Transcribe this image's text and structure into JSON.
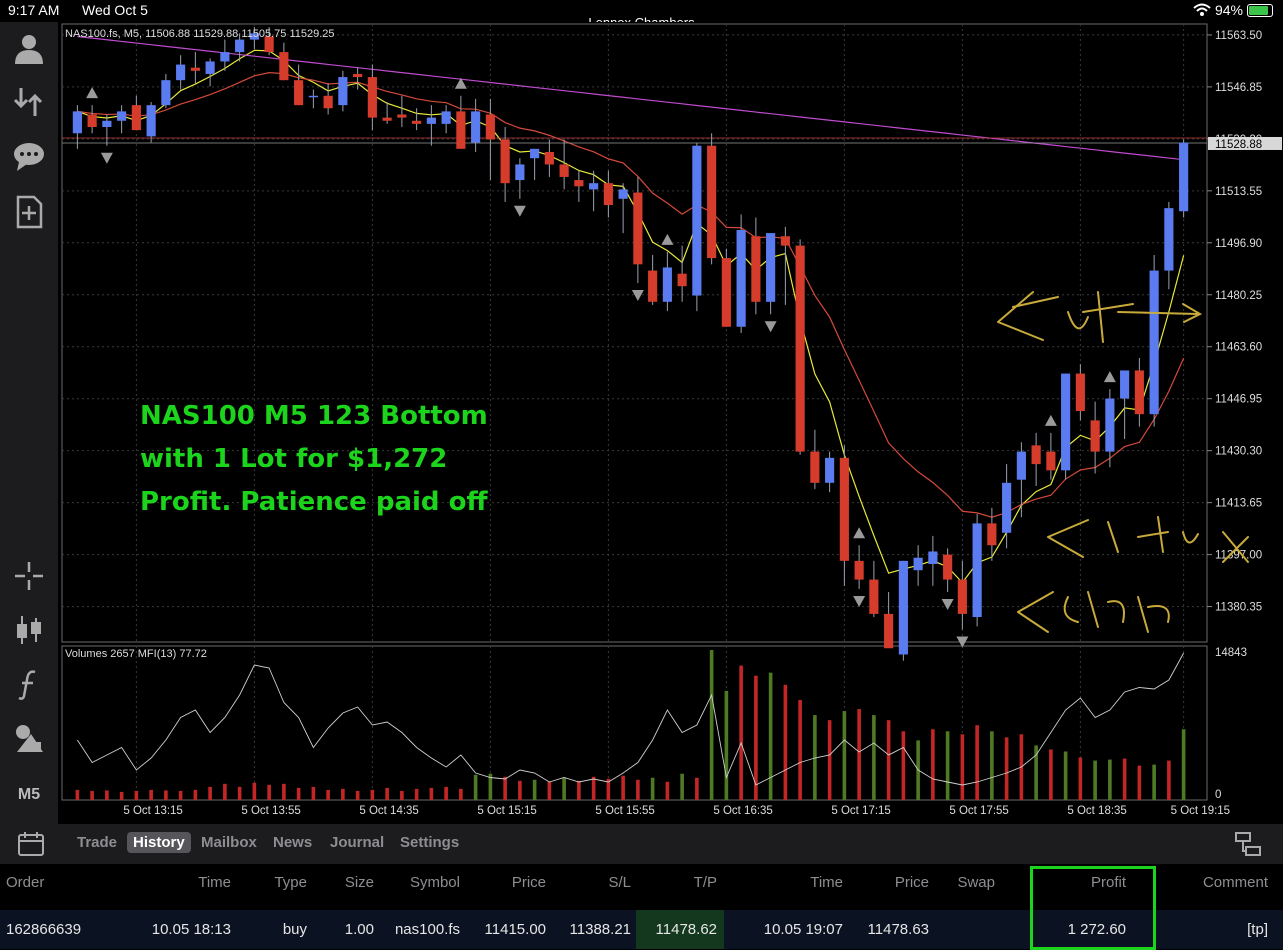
{
  "status_bar": {
    "time": "9:17 AM",
    "date": "Wed Oct 5",
    "battery": "94%"
  },
  "account_name": "Lennox Chambers",
  "chart_header": "NAS100.fs, M5, 11506.88 11529.88 11505.75 11529.25",
  "volume_header": "Volumes 2657 MFI(13) 77.72",
  "timeframe": "M5",
  "annotation": {
    "line1": "NAS100 M5 123 Bottom",
    "line2": "with 1 Lot for $1,272",
    "line3": "Profit. Patience paid off",
    "handwritten": [
      "Exit",
      "Entry",
      "Stop"
    ]
  },
  "tabs": [
    "Trade",
    "History",
    "Mailbox",
    "News",
    "Journal",
    "Settings"
  ],
  "active_tab": "History",
  "columns": [
    "Order",
    "Time",
    "Type",
    "Size",
    "Symbol",
    "Price",
    "S/L",
    "T/P",
    "Time",
    "Price",
    "Swap",
    "Profit",
    "Comment"
  ],
  "row": {
    "order": "162866639",
    "open_time": "10.05 18:13",
    "type": "buy",
    "size": "1.00",
    "symbol": "nas100.fs",
    "price": "11415.00",
    "sl": "11388.21",
    "tp": "11478.62",
    "close_time": "10.05 19:07",
    "close_price": "11478.63",
    "swap": "",
    "profit": "1 272.60",
    "comment": "[tp]"
  },
  "colors": {
    "bull": "#5b7cf0",
    "bear": "#d63c2c",
    "ma_fast": "#e8e83a",
    "ma_mid": "#d44a3a",
    "ma_slow": "#c04ad0",
    "vol_up": "#4f7a24",
    "vol_down": "#c42626",
    "highlight": "#1bd41b"
  },
  "chart_data": {
    "type": "candlestick",
    "title": "NAS100.fs, M5",
    "price_ticks": [
      "11563.50",
      "11546.85",
      "11530.20",
      "11513.55",
      "11496.90",
      "11480.25",
      "11463.60",
      "11446.95",
      "11430.30",
      "11413.65",
      "11397.00",
      "11380.35"
    ],
    "current_price_label": "11528.88",
    "ylim": [
      11369,
      11567
    ],
    "time_ticks": [
      "5 Oct 13:15",
      "5 Oct 13:55",
      "5 Oct 14:35",
      "5 Oct 15:15",
      "5 Oct 15:55",
      "5 Oct 16:35",
      "5 Oct 17:15",
      "5 Oct 17:55",
      "5 Oct 18:35",
      "5 Oct 19:15"
    ],
    "volume_ticks": [
      "14843",
      "0"
    ],
    "candles": [
      [
        11532,
        11541,
        11527,
        11539
      ],
      [
        11538,
        11541,
        11532,
        11534
      ],
      [
        11534,
        11538,
        11528,
        11536
      ],
      [
        11536,
        11541,
        11532,
        11539
      ],
      [
        11541,
        11544,
        11534,
        11533
      ],
      [
        11531,
        11542,
        11529,
        11541
      ],
      [
        11541,
        11551,
        11540,
        11549
      ],
      [
        11549,
        11557,
        11546,
        11554
      ],
      [
        11553,
        11558,
        11548,
        11552
      ],
      [
        11551,
        11556,
        11547,
        11555
      ],
      [
        11555,
        11562,
        11552,
        11558
      ],
      [
        11558,
        11564,
        11555,
        11562
      ],
      [
        11562,
        11566,
        11559,
        11564
      ],
      [
        11563,
        11566,
        11557,
        11558
      ],
      [
        11558,
        11561,
        11549,
        11549
      ],
      [
        11549,
        11554,
        11541,
        11541
      ],
      [
        11544,
        11546,
        11540,
        11544
      ],
      [
        11544,
        11548,
        11538,
        11540
      ],
      [
        11541,
        11552,
        11539,
        11550
      ],
      [
        11551,
        11553,
        11546,
        11550
      ],
      [
        11550,
        11554,
        11533,
        11537
      ],
      [
        11537,
        11542,
        11535,
        11536
      ],
      [
        11538,
        11544,
        11534,
        11537
      ],
      [
        11536,
        11540,
        11533,
        11535
      ],
      [
        11535,
        11541,
        11528,
        11537
      ],
      [
        11535,
        11541,
        11532,
        11539
      ],
      [
        11539,
        11544,
        11530,
        11527
      ],
      [
        11529,
        11543,
        11526,
        11539
      ],
      [
        11538,
        11543,
        11517,
        11530
      ],
      [
        11530,
        11534,
        11510,
        11516
      ],
      [
        11517,
        11524,
        11511,
        11522
      ],
      [
        11524,
        11527,
        11517,
        11527
      ],
      [
        11526,
        11530,
        11518,
        11522
      ],
      [
        11522,
        11530,
        11514,
        11518
      ],
      [
        11517,
        11520,
        11510,
        11515
      ],
      [
        11514,
        11520,
        11507,
        11516
      ],
      [
        11516,
        11520,
        11505,
        11509
      ],
      [
        11511,
        11516,
        11500,
        11514
      ],
      [
        11513,
        11518,
        11484,
        11490
      ],
      [
        11488,
        11493,
        11477,
        11478
      ],
      [
        11478,
        11494,
        11475,
        11489
      ],
      [
        11487,
        11496,
        11478,
        11483
      ],
      [
        11480,
        11529,
        11475,
        11528
      ],
      [
        11528,
        11532,
        11490,
        11492
      ],
      [
        11492,
        11495,
        11470,
        11470
      ],
      [
        11470,
        11506,
        11468,
        11501
      ],
      [
        11499,
        11505,
        11474,
        11478
      ],
      [
        11478,
        11500,
        11474,
        11500
      ],
      [
        11499,
        11502,
        11477,
        11496
      ],
      [
        11496,
        11498,
        11429,
        11430
      ],
      [
        11430,
        11437,
        11418,
        11420
      ],
      [
        11420,
        11430,
        11417,
        11428
      ],
      [
        11428,
        11432,
        11387,
        11395
      ],
      [
        11395,
        11400,
        11386,
        11389
      ],
      [
        11389,
        11395,
        11377,
        11378
      ],
      [
        11378,
        11385,
        11370,
        11367
      ],
      [
        11365,
        11395,
        11363,
        11395
      ],
      [
        11392,
        11400,
        11387,
        11396
      ],
      [
        11394,
        11403,
        11387,
        11398
      ],
      [
        11397,
        11399,
        11385,
        11389
      ],
      [
        11389,
        11395,
        11373,
        11378
      ],
      [
        11377,
        11410,
        11374,
        11407
      ],
      [
        11407,
        11412,
        11395,
        11400
      ],
      [
        11404,
        11426,
        11399,
        11420
      ],
      [
        11421,
        11433,
        11409,
        11430
      ],
      [
        11432,
        11436,
        11419,
        11426
      ],
      [
        11430,
        11436,
        11421,
        11424
      ],
      [
        11424,
        11455,
        11421,
        11455
      ],
      [
        11455,
        11458,
        11440,
        11443
      ],
      [
        11440,
        11446,
        11423,
        11430
      ],
      [
        11430,
        11450,
        11425,
        11447
      ],
      [
        11447,
        11455,
        11434,
        11456
      ],
      [
        11456,
        11460,
        11438,
        11442
      ],
      [
        11442,
        11493,
        11438,
        11488
      ],
      [
        11488,
        11510,
        11482,
        11508
      ],
      [
        11507,
        11530,
        11505,
        11529
      ]
    ],
    "volumes": [
      [
        1000,
        0
      ],
      [
        900,
        0
      ],
      [
        950,
        0
      ],
      [
        800,
        0
      ],
      [
        900,
        0
      ],
      [
        1000,
        0
      ],
      [
        950,
        0
      ],
      [
        900,
        0
      ],
      [
        1000,
        0
      ],
      [
        1300,
        0
      ],
      [
        1600,
        0
      ],
      [
        1300,
        0
      ],
      [
        1700,
        0
      ],
      [
        1500,
        0
      ],
      [
        1600,
        0
      ],
      [
        1200,
        0
      ],
      [
        1300,
        0
      ],
      [
        1000,
        0
      ],
      [
        1100,
        0
      ],
      [
        900,
        0
      ],
      [
        1000,
        0
      ],
      [
        1200,
        0
      ],
      [
        900,
        0
      ],
      [
        1100,
        0
      ],
      [
        1200,
        0
      ],
      [
        1300,
        0
      ],
      [
        1100,
        0
      ],
      [
        2500,
        1
      ],
      [
        2600,
        1
      ],
      [
        2300,
        0
      ],
      [
        1900,
        0
      ],
      [
        2000,
        1
      ],
      [
        1800,
        0
      ],
      [
        2200,
        1
      ],
      [
        1900,
        0
      ],
      [
        2300,
        0
      ],
      [
        2100,
        0
      ],
      [
        2400,
        0
      ],
      [
        2000,
        0
      ],
      [
        2200,
        1
      ],
      [
        1800,
        0
      ],
      [
        2600,
        1
      ],
      [
        2200,
        0
      ],
      [
        14843,
        1
      ],
      [
        10800,
        1
      ],
      [
        13300,
        0
      ],
      [
        12300,
        0
      ],
      [
        12600,
        1
      ],
      [
        11400,
        0
      ],
      [
        9900,
        0
      ],
      [
        8400,
        1
      ],
      [
        7900,
        0
      ],
      [
        8800,
        1
      ],
      [
        9000,
        0
      ],
      [
        8400,
        1
      ],
      [
        7900,
        0
      ],
      [
        6800,
        0
      ],
      [
        5900,
        1
      ],
      [
        7000,
        0
      ],
      [
        6800,
        1
      ],
      [
        6500,
        0
      ],
      [
        7400,
        0
      ],
      [
        6800,
        1
      ],
      [
        6200,
        0
      ],
      [
        6500,
        0
      ],
      [
        5400,
        1
      ],
      [
        5000,
        0
      ],
      [
        4800,
        1
      ],
      [
        4200,
        0
      ],
      [
        3900,
        1
      ],
      [
        4000,
        1
      ],
      [
        4100,
        0
      ],
      [
        3400,
        0
      ],
      [
        3500,
        1
      ],
      [
        3900,
        0
      ],
      [
        7000,
        1
      ],
      [
        3800,
        0
      ],
      [
        1800,
        0
      ]
    ],
    "arrows_up": [
      1,
      26,
      40,
      53,
      66,
      70,
      76,
      87
    ],
    "arrows_down": [
      2,
      30,
      38,
      47,
      53,
      59,
      60,
      79,
      99
    ]
  }
}
